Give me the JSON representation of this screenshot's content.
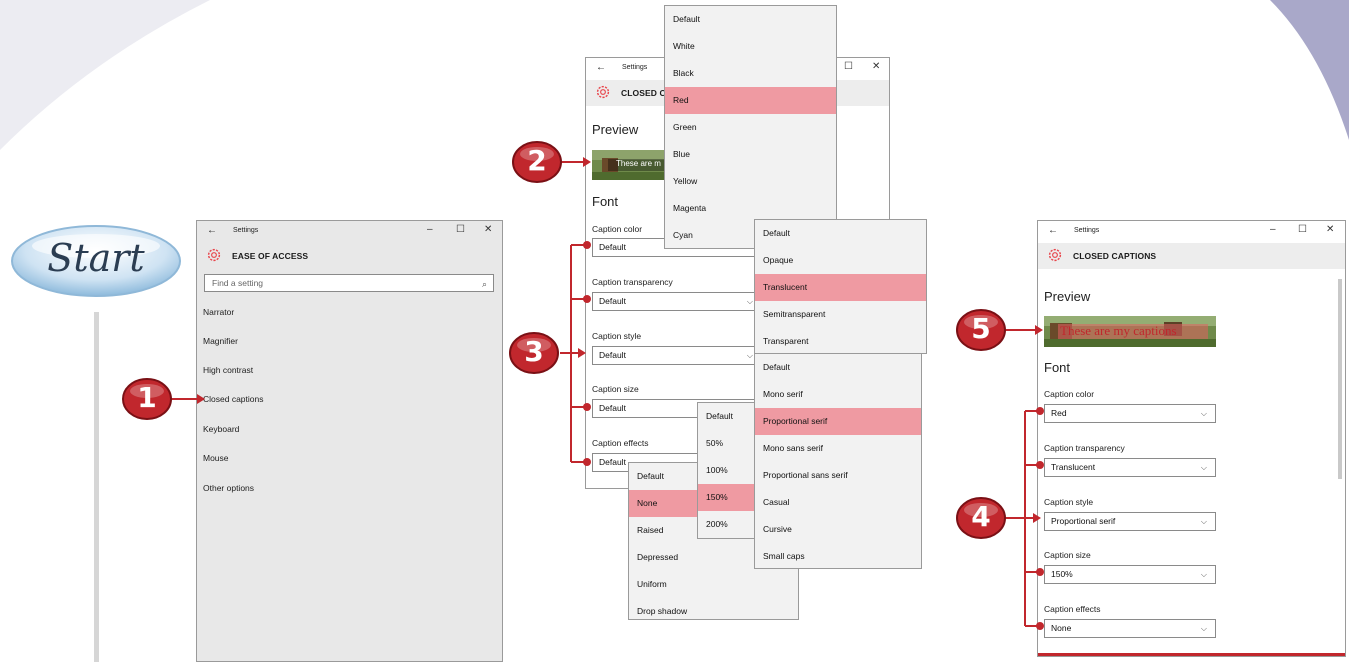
{
  "start": {
    "label": "Start"
  },
  "steps": [
    "1",
    "2",
    "3",
    "4",
    "5"
  ],
  "colors": {
    "accent_red": "#c1272d",
    "highlight": "#ef9aa2",
    "header_gray": "#ededed",
    "gear_red": "#e8454b"
  },
  "win1": {
    "title": "Settings",
    "header": "EASE OF ACCESS",
    "search_placeholder": "Find a setting",
    "nav": [
      "Narrator",
      "Magnifier",
      "High contrast",
      "Closed captions",
      "Keyboard",
      "Mouse",
      "Other options"
    ]
  },
  "win2": {
    "title": "Settings",
    "header": "CLOSED CA",
    "preview_heading": "Preview",
    "preview_text": "These are m",
    "font_heading": "Font",
    "fields": [
      {
        "label": "Caption color",
        "value": "Default"
      },
      {
        "label": "Caption transparency",
        "value": "Default"
      },
      {
        "label": "Caption style",
        "value": "Default"
      },
      {
        "label": "Caption size",
        "value": "Default"
      },
      {
        "label": "Caption effects",
        "value": "Default"
      }
    ]
  },
  "color_menu": {
    "options": [
      "Default",
      "White",
      "Black",
      "Red",
      "Green",
      "Blue",
      "Yellow",
      "Magenta",
      "Cyan"
    ],
    "selected": "Red"
  },
  "transparency_menu": {
    "options": [
      "Default",
      "Opaque",
      "Translucent",
      "Semitransparent",
      "Transparent"
    ],
    "selected": "Translucent"
  },
  "style_menu": {
    "options": [
      "Default",
      "Mono serif",
      "Proportional serif",
      "Mono sans serif",
      "Proportional sans serif",
      "Casual",
      "Cursive",
      "Small caps"
    ],
    "selected": "Proportional serif"
  },
  "size_menu": {
    "options": [
      "Default",
      "50%",
      "100%",
      "150%",
      "200%"
    ],
    "selected": "150%"
  },
  "effects_menu": {
    "options": [
      "Default",
      "None",
      "Raised",
      "Depressed",
      "Uniform",
      "Drop shadow"
    ],
    "selected": "None"
  },
  "win3": {
    "title": "Settings",
    "header": "CLOSED CAPTIONS",
    "preview_heading": "Preview",
    "preview_text": "These are my captions",
    "font_heading": "Font",
    "fields": [
      {
        "label": "Caption color",
        "value": "Red"
      },
      {
        "label": "Caption transparency",
        "value": "Translucent"
      },
      {
        "label": "Caption style",
        "value": "Proportional serif"
      },
      {
        "label": "Caption size",
        "value": "150%"
      },
      {
        "label": "Caption effects",
        "value": "None"
      }
    ]
  }
}
